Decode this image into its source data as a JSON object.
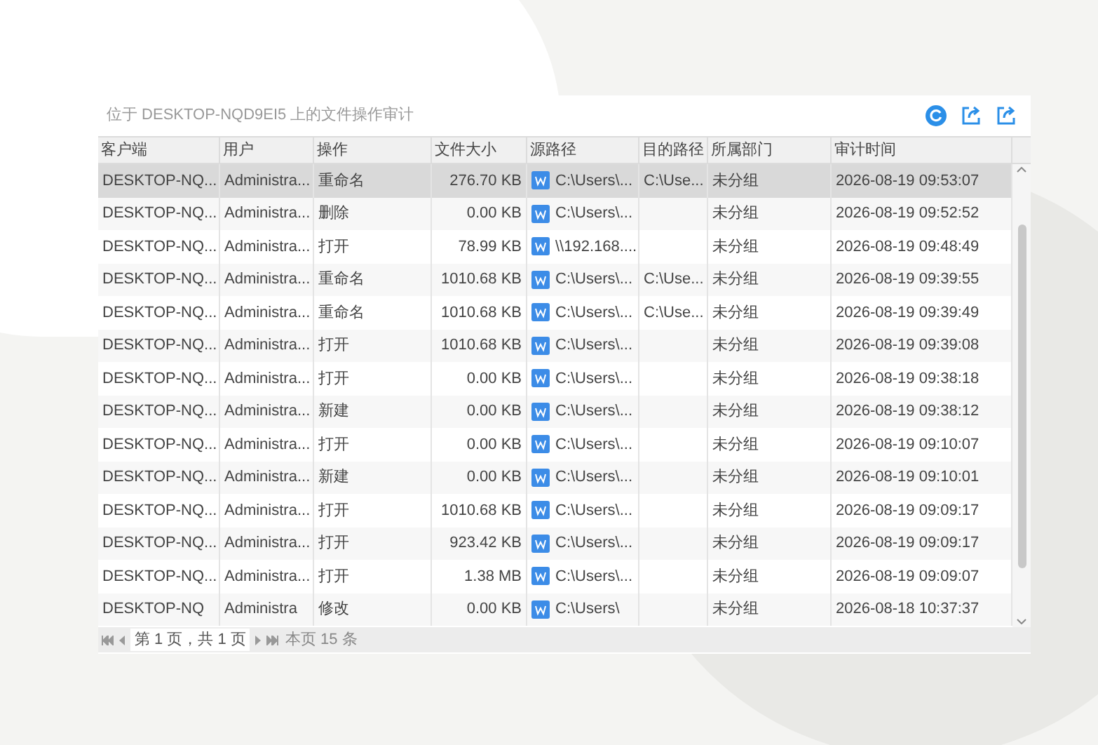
{
  "title": "位于 DESKTOP-NQD9EI5 上的文件操作审计",
  "table": {
    "columns": [
      "客户端",
      "用户",
      "操作",
      "文件大小",
      "源路径",
      "目的路径",
      "所属部门",
      "审计时间"
    ],
    "rows": [
      {
        "selected": true,
        "cells": [
          "DESKTOP-NQ...",
          "Administra...",
          "重命名",
          "276.70 KB",
          "C:\\Users\\...",
          "C:\\Use...",
          "未分组",
          "2026-08-19 09:53:07"
        ]
      },
      {
        "selected": false,
        "cells": [
          "DESKTOP-NQ...",
          "Administra...",
          "删除",
          "0.00 KB",
          "C:\\Users\\...",
          "",
          "未分组",
          "2026-08-19 09:52:52"
        ]
      },
      {
        "selected": false,
        "cells": [
          "DESKTOP-NQ...",
          "Administra...",
          "打开",
          "78.99 KB",
          "\\\\192.168....",
          "",
          "未分组",
          "2026-08-19 09:48:49"
        ]
      },
      {
        "selected": false,
        "cells": [
          "DESKTOP-NQ...",
          "Administra...",
          "重命名",
          "1010.68 KB",
          "C:\\Users\\...",
          "C:\\Use...",
          "未分组",
          "2026-08-19 09:39:55"
        ]
      },
      {
        "selected": false,
        "cells": [
          "DESKTOP-NQ...",
          "Administra...",
          "重命名",
          "1010.68 KB",
          "C:\\Users\\...",
          "C:\\Use...",
          "未分组",
          "2026-08-19 09:39:49"
        ]
      },
      {
        "selected": false,
        "cells": [
          "DESKTOP-NQ...",
          "Administra...",
          "打开",
          "1010.68 KB",
          "C:\\Users\\...",
          "",
          "未分组",
          "2026-08-19 09:39:08"
        ]
      },
      {
        "selected": false,
        "cells": [
          "DESKTOP-NQ...",
          "Administra...",
          "打开",
          "0.00 KB",
          "C:\\Users\\...",
          "",
          "未分组",
          "2026-08-19 09:38:18"
        ]
      },
      {
        "selected": false,
        "cells": [
          "DESKTOP-NQ...",
          "Administra...",
          "新建",
          "0.00 KB",
          "C:\\Users\\...",
          "",
          "未分组",
          "2026-08-19 09:38:12"
        ]
      },
      {
        "selected": false,
        "cells": [
          "DESKTOP-NQ...",
          "Administra...",
          "打开",
          "0.00 KB",
          "C:\\Users\\...",
          "",
          "未分组",
          "2026-08-19 09:10:07"
        ]
      },
      {
        "selected": false,
        "cells": [
          "DESKTOP-NQ...",
          "Administra...",
          "新建",
          "0.00 KB",
          "C:\\Users\\...",
          "",
          "未分组",
          "2026-08-19 09:10:01"
        ]
      },
      {
        "selected": false,
        "cells": [
          "DESKTOP-NQ...",
          "Administra...",
          "打开",
          "1010.68 KB",
          "C:\\Users\\...",
          "",
          "未分组",
          "2026-08-19 09:09:17"
        ]
      },
      {
        "selected": false,
        "cells": [
          "DESKTOP-NQ...",
          "Administra...",
          "打开",
          "923.42 KB",
          "C:\\Users\\...",
          "",
          "未分组",
          "2026-08-19 09:09:17"
        ]
      },
      {
        "selected": false,
        "cells": [
          "DESKTOP-NQ...",
          "Administra...",
          "打开",
          "1.38 MB",
          "C:\\Users\\...",
          "",
          "未分组",
          "2026-08-19 09:09:07"
        ]
      },
      {
        "selected": false,
        "cells": [
          "DESKTOP-NQ",
          "Administra",
          "修改",
          "0.00 KB",
          "C:\\Users\\",
          "",
          "未分组",
          "2026-08-18 10:37:37"
        ]
      }
    ]
  },
  "pager": {
    "page_info": "第 1 页，共 1 页",
    "count": "本页 15 条"
  }
}
